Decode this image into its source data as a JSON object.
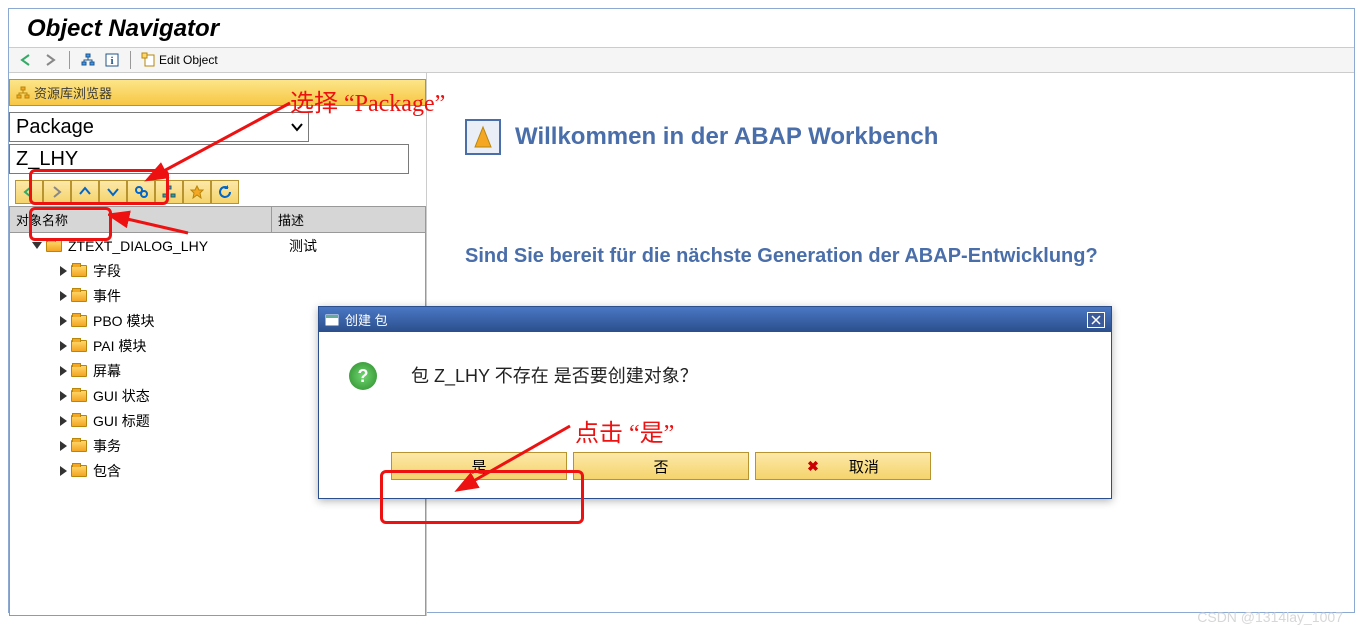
{
  "title": "Object Navigator",
  "toolbar": {
    "edit_label": "Edit Object"
  },
  "annotations": {
    "select_package": "选择 “Package”",
    "click_yes": "点击 “是”"
  },
  "repo": {
    "browser_label": "资源库浏览器",
    "dropdown_value": "Package",
    "input_value": "Z_LHY"
  },
  "tree": {
    "col_name": "对象名称",
    "col_desc": "描述",
    "root": {
      "label": "ZTEXT_DIALOG_LHY",
      "desc": "测试"
    },
    "children": [
      {
        "label": "字段"
      },
      {
        "label": "事件"
      },
      {
        "label": "PBO 模块"
      },
      {
        "label": "PAI 模块"
      },
      {
        "label": "屏幕"
      },
      {
        "label": "GUI 状态"
      },
      {
        "label": "GUI 标题"
      },
      {
        "label": "事务"
      },
      {
        "label": "包含"
      }
    ]
  },
  "welcome": {
    "title": "Willkommen in der ABAP Workbench",
    "subheading": "Sind Sie bereit für die nächste Generation der ABAP-Entwicklung?"
  },
  "dialog": {
    "title": "创建 包",
    "message": "包 Z_LHY 不存在 是否要创建对象？",
    "yes": "是",
    "no": "否",
    "cancel": "取消"
  },
  "watermark": "CSDN @1314lay_1007"
}
